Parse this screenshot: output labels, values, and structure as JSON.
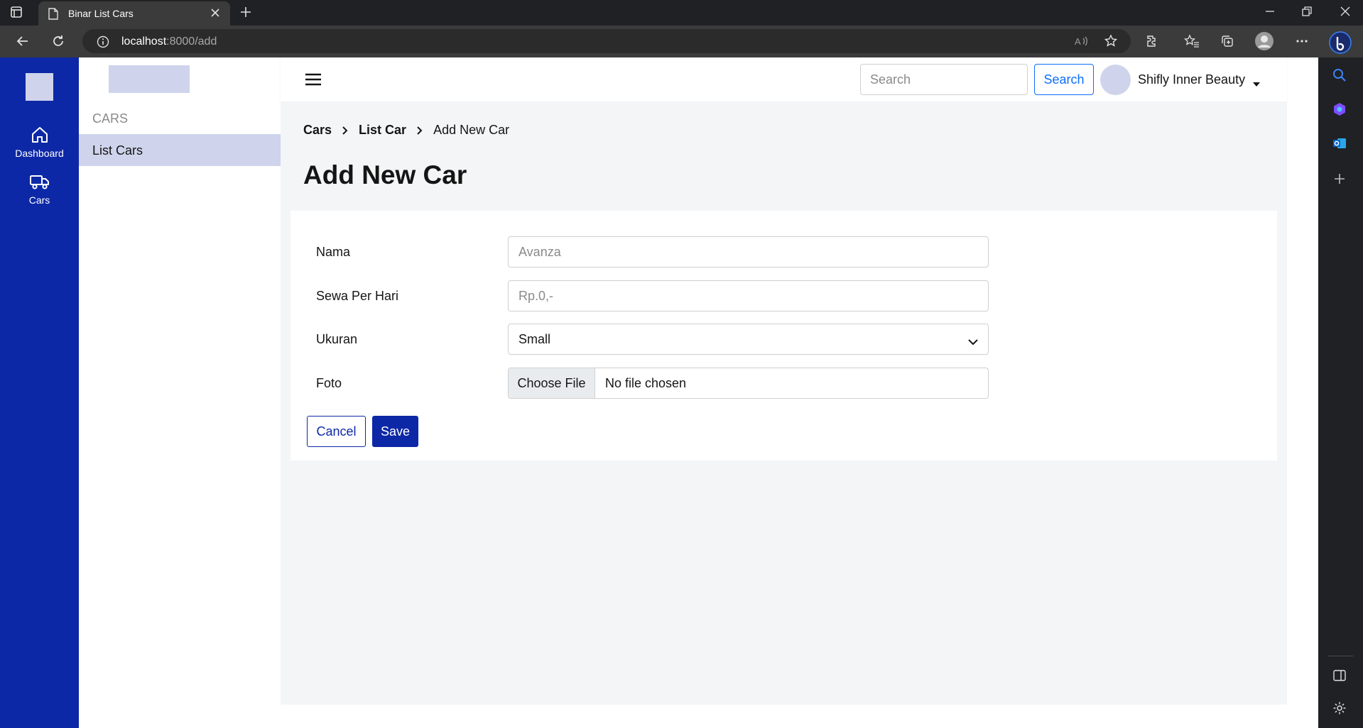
{
  "browser": {
    "tab_title": "Binar List Cars",
    "url_host": "localhost",
    "url_rest": ":8000/add"
  },
  "rail": {
    "items": [
      {
        "label": "Dashboard",
        "icon": "home-icon"
      },
      {
        "label": "Cars",
        "icon": "truck-icon"
      }
    ]
  },
  "sidebar": {
    "section_title": "CARS",
    "items": [
      {
        "label": "List Cars",
        "active": true
      }
    ]
  },
  "header": {
    "search_placeholder": "Search",
    "search_button": "Search",
    "user_name": "Shifly Inner Beauty"
  },
  "breadcrumb": [
    {
      "label": "Cars"
    },
    {
      "label": "List Car"
    },
    {
      "label": "Add New Car"
    }
  ],
  "page_title": "Add New Car",
  "form": {
    "nama": {
      "label": "Nama",
      "placeholder": "Avanza",
      "value": ""
    },
    "sewa": {
      "label": "Sewa Per Hari",
      "placeholder": "Rp.0,-",
      "value": ""
    },
    "ukuran": {
      "label": "Ukuran",
      "selected": "Small"
    },
    "foto": {
      "label": "Foto",
      "button": "Choose File",
      "status": "No file chosen"
    }
  },
  "actions": {
    "cancel": "Cancel",
    "save": "Save"
  },
  "colors": {
    "brand": "#0d28a6",
    "accent_light": "#cfd4ec",
    "background": "#f4f5f7",
    "link_blue": "#0d6efd"
  }
}
